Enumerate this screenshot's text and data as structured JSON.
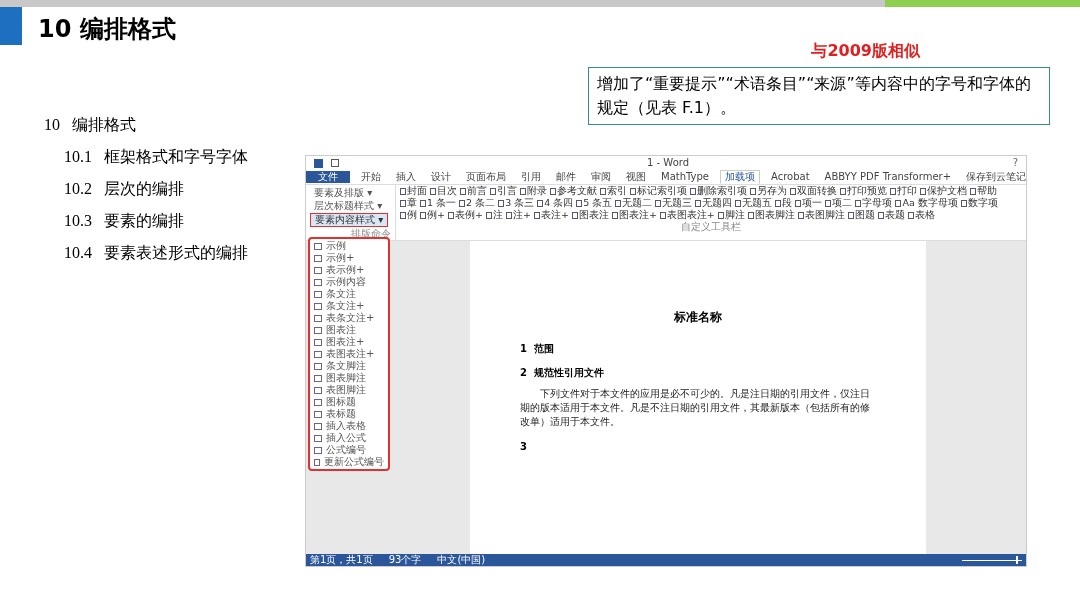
{
  "slide": {
    "title": "10 编排格式",
    "note": "与2009版相似",
    "callout": "增加了“重要提示”“术语条目”“来源”等内容中的字号和字体的规定（见表 F.1）。",
    "outline": [
      {
        "number": "10",
        "text": "编排格式",
        "children": [
          {
            "number": "10.1",
            "text": "框架格式和字号字体"
          },
          {
            "number": "10.2",
            "text": "层次的编排"
          },
          {
            "number": "10.3",
            "text": "要素的编排"
          },
          {
            "number": "10.4",
            "text": "要素表述形式的编排"
          }
        ]
      }
    ]
  },
  "word": {
    "title": "1 - Word",
    "help": "?",
    "tabs": [
      {
        "label": "文件",
        "selected": false,
        "kind": "file"
      },
      {
        "label": "开始",
        "selected": false
      },
      {
        "label": "插入",
        "selected": false
      },
      {
        "label": "设计",
        "selected": false
      },
      {
        "label": "页面布局",
        "selected": false
      },
      {
        "label": "引用",
        "selected": false
      },
      {
        "label": "邮件",
        "selected": false
      },
      {
        "label": "审阅",
        "selected": false
      },
      {
        "label": "视图",
        "selected": false
      },
      {
        "label": "MathType",
        "selected": false
      },
      {
        "label": "加载项",
        "selected": true
      },
      {
        "label": "Acrobat",
        "selected": false
      },
      {
        "label": "ABBYY PDF Transformer+",
        "selected": false
      },
      {
        "label": "保存到云笔记",
        "selected": false
      }
    ],
    "style_menus": [
      {
        "label": "要素及排版 ▾",
        "selected": false
      },
      {
        "label": "层次标题样式 ▾",
        "selected": false
      },
      {
        "label": "要素内容样式 ▾",
        "selected": true
      }
    ],
    "left_group_label": "排版命令",
    "ribbon_rows": [
      [
        "封面",
        "目次",
        "前言",
        "引言",
        "附录",
        "参考文献",
        "索引",
        "标记索引项",
        "删除索引项",
        "另存为",
        "双面转换",
        "打印预览",
        "打印",
        "保护文档",
        "帮助"
      ],
      [
        "章",
        "1 条一",
        "2 条二",
        "3 条三",
        "4 条四",
        "5 条五",
        "无题二",
        "无题三",
        "无题四",
        "无题五",
        "段",
        "项一",
        "项二",
        "字母项",
        "Aa 数字母项",
        "数字项"
      ],
      [
        "例",
        "例+",
        "表例+",
        "注",
        "注+",
        "表注+",
        "图表注",
        "图表注+",
        "表图表注+",
        "脚注",
        "图表脚注",
        "表图脚注",
        "图题",
        "表题",
        "表格"
      ]
    ],
    "ribbon_group_label": "自定义工具栏",
    "menu": [
      "示例",
      "示例+",
      "表示例+",
      "示例内容",
      "条文注",
      "条文注+",
      "表条文注+",
      "图表注",
      "图表注+",
      "表图表注+",
      "条文脚注",
      "图表脚注",
      "表图脚注",
      "图标题",
      "表标题",
      "插入表格",
      "插入公式",
      "公式编号",
      "更新公式编号"
    ],
    "document": {
      "title": "标准名称",
      "sections": [
        {
          "number": "1",
          "heading": "范围"
        },
        {
          "number": "2",
          "heading": "规范性引用文件",
          "body": "下列文件对于本文件的应用是必不可少的。凡是注日期的引用文件，仅注日期的版本适用于本文件。凡是不注日期的引用文件，其最新版本（包括所有的修改单）适用于本文件。"
        },
        {
          "number": "3"
        }
      ]
    },
    "status_bar": [
      "第1页，共1页",
      "93个字",
      "中文(中国)"
    ],
    "zoom": {
      "level": 0.9
    }
  }
}
